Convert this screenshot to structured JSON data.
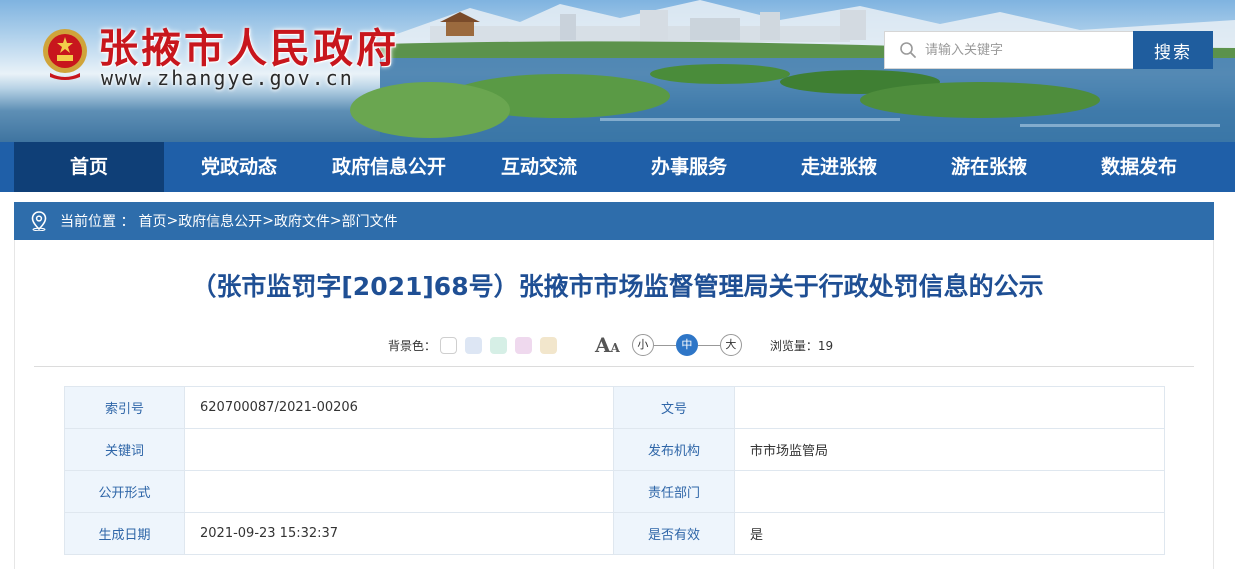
{
  "header": {
    "site_title": "张掖市人民政府",
    "site_domain": "www.zhangye.gov.cn",
    "search": {
      "placeholder": "请输入关键字",
      "button_label": "搜索"
    }
  },
  "nav": {
    "items": [
      {
        "label": "首页",
        "active": true
      },
      {
        "label": "党政动态"
      },
      {
        "label": "政府信息公开"
      },
      {
        "label": "互动交流"
      },
      {
        "label": "办事服务"
      },
      {
        "label": "走进张掖"
      },
      {
        "label": "游在张掖"
      },
      {
        "label": "数据发布"
      }
    ]
  },
  "breadcrumb": {
    "label": "当前位置 ：",
    "items": [
      "首页",
      "政府信息公开",
      "政府文件",
      "部门文件"
    ],
    "separator": ">"
  },
  "article": {
    "title": "（张市监罚字[2021]68号）张掖市市场监督管理局关于行政处罚信息的公示"
  },
  "tools": {
    "bg_label": "背景色：",
    "bg_colors": [
      "#ffffff",
      "#dde6f4",
      "#d6efe6",
      "#efd9ee",
      "#f2e6cc"
    ],
    "font_icon_big": "A",
    "font_icon_small": "A",
    "sizes": [
      "小",
      "中",
      "大"
    ],
    "active_size": "中",
    "views_label": "浏览量：",
    "views_count": "19"
  },
  "meta": {
    "rows": [
      {
        "k1": "索引号",
        "v1": "620700087/2021-00206",
        "k2": "文号",
        "v2": ""
      },
      {
        "k1": "关键词",
        "v1": "",
        "k2": "发布机构",
        "v2": "市市场监管局"
      },
      {
        "k1": "公开形式",
        "v1": "",
        "k2": "责任部门",
        "v2": ""
      },
      {
        "k1": "生成日期",
        "v1": "2021-09-23 15:32:37",
        "k2": "是否有效",
        "v2": "是"
      }
    ]
  },
  "colors": {
    "nav_bg": "#1f5fa8",
    "nav_active": "#0f3f77",
    "title_blue": "#1f4f94",
    "site_title_red": "#c8161d",
    "search_button": "#1f5d9e"
  }
}
